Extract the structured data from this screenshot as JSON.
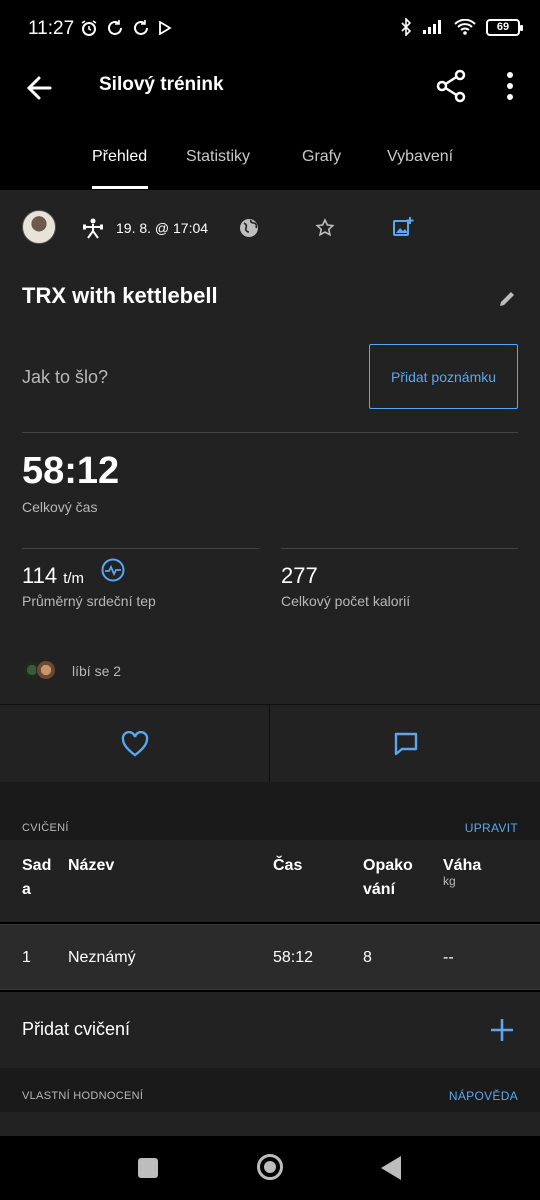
{
  "status_bar": {
    "time": "11:27",
    "battery": "69"
  },
  "app_bar": {
    "title": "Silový trénink"
  },
  "tabs": [
    {
      "label": "Přehled",
      "active": true
    },
    {
      "label": "Statistiky",
      "active": false
    },
    {
      "label": "Grafy",
      "active": false
    },
    {
      "label": "Vybavení",
      "active": false
    }
  ],
  "activity": {
    "date": "19. 8. @ 17:04",
    "name": "TRX with kettlebell",
    "prompt": "Jak to šlo?",
    "add_note_label": "Přidat poznámku",
    "total_time": "58:12",
    "total_time_label": "Celkový čas",
    "avg_hr_value": "114",
    "avg_hr_unit": "t/m",
    "avg_hr_label": "Průměrný srdeční tep",
    "calories_value": "277",
    "calories_label": "Celkový počet kalorií",
    "likes_text": "líbí se 2"
  },
  "exercises": {
    "section_title": "CVIČENÍ",
    "edit_link": "UPRAVIT",
    "columns": {
      "set_line1": "Sad",
      "set_line2": "a",
      "name": "Název",
      "time": "Čas",
      "reps_line1": "Opako",
      "reps_line2": "vání",
      "weight": "Váha",
      "weight_unit": "kg"
    },
    "rows": [
      {
        "set": "1",
        "name": "Neznámý",
        "time": "58:12",
        "reps": "8",
        "weight": "--"
      }
    ],
    "add_label": "Přidat cvičení"
  },
  "self_rating": {
    "section_title": "VLASTNÍ HODNOCENÍ",
    "help_link": "NÁPOVĚDA"
  },
  "colors": {
    "accent": "#5aa6f0",
    "background": "#000000",
    "card": "#222222"
  }
}
